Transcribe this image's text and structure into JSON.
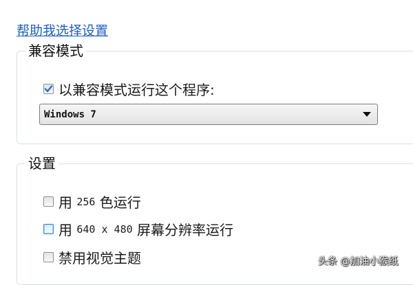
{
  "help_link": "帮助我选择设置",
  "compat_group": {
    "title": "兼容模式",
    "run_in_compat_checkbox": {
      "label": "以兼容模式运行这个程序:",
      "checked": true
    },
    "os_select": {
      "value": "Windows 7"
    }
  },
  "settings_group": {
    "title": "设置",
    "color_256": {
      "label_pre": "用 ",
      "value": "256",
      "label_post": " 色运行",
      "checked": false
    },
    "res_640": {
      "label_pre": "用 ",
      "value": "640 x 480",
      "label_post": " 屏幕分辨率运行",
      "checked": false
    },
    "disable_themes": {
      "label": "禁用视觉主题",
      "checked": false
    }
  },
  "watermark": "头条 @加油小猴纸",
  "colors": {
    "link": "#1f5ec8",
    "check": "#2c6fb4",
    "focus_border": "#3a8fd8"
  },
  "icons": [
    "checkmark-icon",
    "dropdown-arrow-icon"
  ]
}
